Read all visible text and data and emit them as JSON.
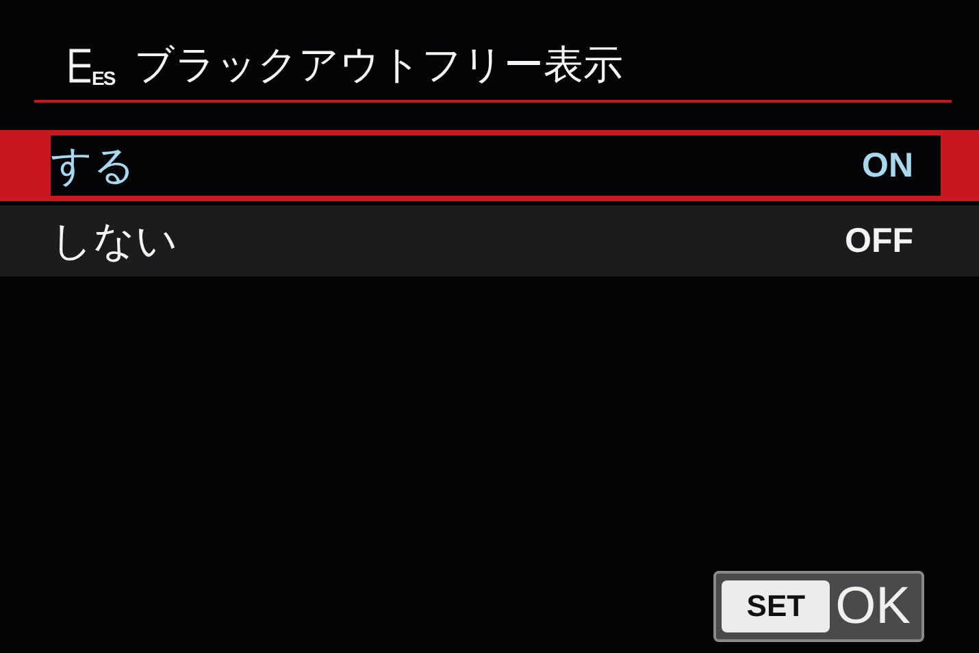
{
  "title": {
    "icon_text": "ES",
    "text": "ブラックアウトフリー表示"
  },
  "options": [
    {
      "label": "する",
      "value": "ON",
      "selected": true
    },
    {
      "label": "しない",
      "value": "OFF",
      "selected": false
    }
  ],
  "confirm_button": {
    "key": "SET",
    "label": "OK"
  }
}
